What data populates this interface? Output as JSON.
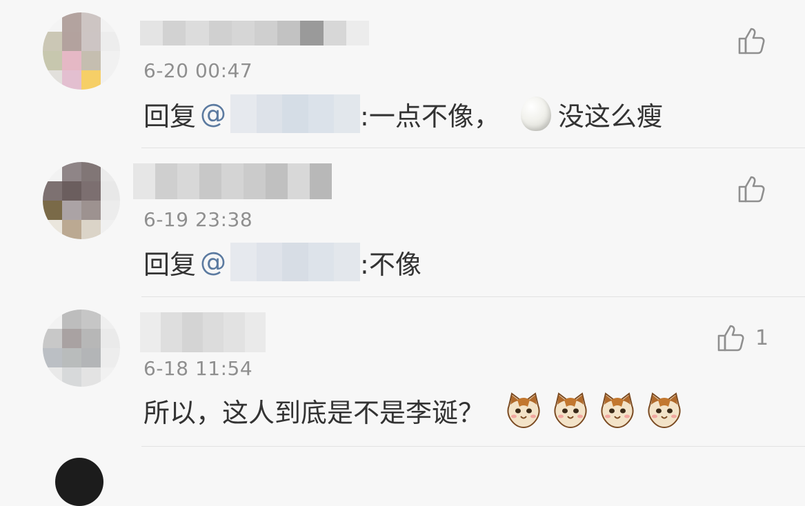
{
  "comments": [
    {
      "time": "6-20 00:47",
      "reply_prefix": "回复",
      "at_sign": "@",
      "after_mention": ":一点不像，",
      "after_emoji": "没这么瘦",
      "likes": ""
    },
    {
      "time": "6-19 23:38",
      "reply_prefix": "回复",
      "at_sign": "@",
      "after_mention": ":不像",
      "likes": ""
    },
    {
      "time": "6-18 11:54",
      "text": "所以，这人到底是不是李诞？",
      "likes": "1"
    }
  ],
  "icons": {
    "like": "thumbs-up-icon",
    "egg": "egg-emoji",
    "cat": "cat-face-emoji"
  },
  "colors": {
    "background": "#f7f7f7",
    "text": "#333333",
    "meta": "#8f8f8f",
    "mention": "#5b7aa0",
    "divider": "#e2e2e2"
  }
}
